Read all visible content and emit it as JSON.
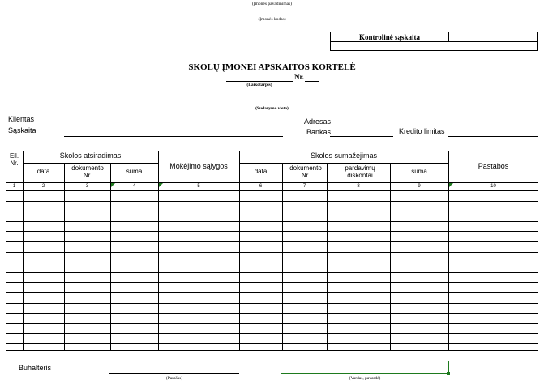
{
  "header": {
    "company_name_caption": "(Įmonės pavadinimas)",
    "company_code_caption": "(Įmonės kodas)"
  },
  "control_box": {
    "label": "Kontrolinė sąskaita",
    "value": ""
  },
  "title": {
    "main": "SKOLŲ ĮMONEI APSKAITOS KORTELĖ",
    "number_label": "Nr.",
    "date_caption": "(Laikotarpis)",
    "place_caption": "(Sudarymo vieta)"
  },
  "fields": {
    "client_label": "Klientas",
    "account_label": "Sąskaita",
    "address_label": "Adresas",
    "bank_label": "Bankas",
    "credit_limit_label": "Kredito limitas"
  },
  "table": {
    "col_no": "Eil. Nr.",
    "group_debt_arise": "Skolos atsiradimas",
    "group_debt_reduce": "Skolos sumažėjimas",
    "col_date": "data",
    "col_doc_no": "dokumento Nr.",
    "col_sum": "suma",
    "col_payment_terms": "Mokėjimo sąlygos",
    "col_date2": "data",
    "col_doc_no2": "dokumento Nr.",
    "col_sales_discounts": "pardavimų diskontai",
    "col_sum2": "suma",
    "col_notes": "Pastabos",
    "column_numbers": [
      "1",
      "2",
      "3",
      "4",
      "5",
      "6",
      "7",
      "8",
      "9",
      "10"
    ]
  },
  "footer": {
    "accountant_label": "Buhalteris",
    "signature_caption": "(Parašas)",
    "name_caption": "(Vardas, pavardė)",
    "name_value": ""
  }
}
